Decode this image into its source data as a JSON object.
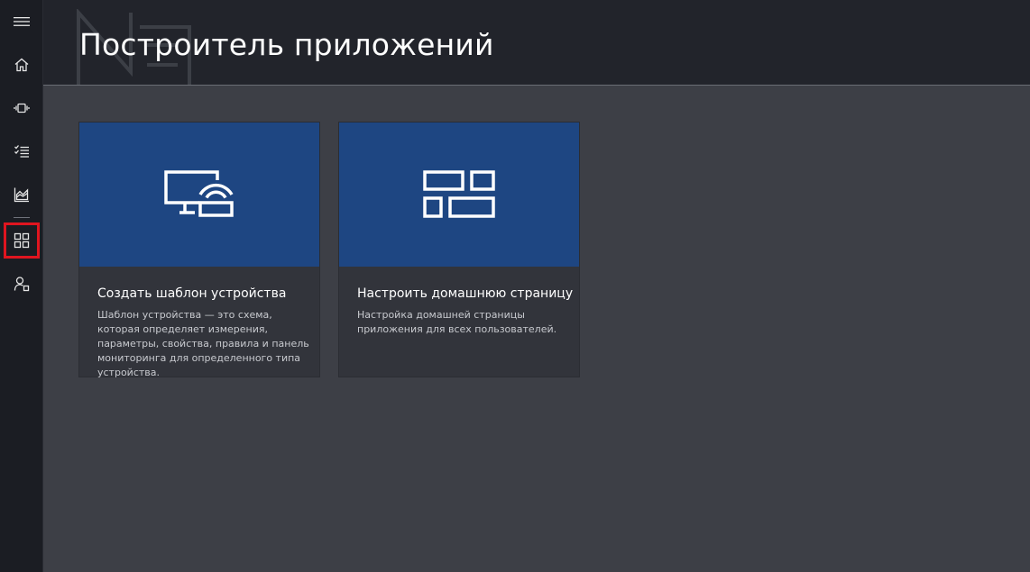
{
  "header": {
    "title": "Построитель приложений"
  },
  "nav": {
    "items": [
      {
        "icon": "menu-icon"
      },
      {
        "icon": "home-icon"
      },
      {
        "icon": "devices-icon"
      },
      {
        "icon": "rules-icon"
      },
      {
        "icon": "analytics-icon"
      },
      {
        "icon": "app-builder-icon",
        "selected": true
      },
      {
        "icon": "administration-icon"
      }
    ]
  },
  "cards": [
    {
      "icon": "device-template-icon",
      "title": "Создать шаблон устройства",
      "description": "Шаблон устройства — это схема, которая определяет измерения, параметры, свойства, правила и панель мониторинга для определенного типа устройства."
    },
    {
      "icon": "dashboard-layout-icon",
      "title": "Настроить домашнюю страницу",
      "description": "Настройка домашней страницы приложения для всех пользователей."
    }
  ],
  "colors": {
    "rail_bg": "#1b1d23",
    "header_bg": "#22242b",
    "content_bg": "#3d3f46",
    "card_banner": "#1e4682",
    "card_body": "#32343b",
    "selection_outline": "#e0151f"
  }
}
